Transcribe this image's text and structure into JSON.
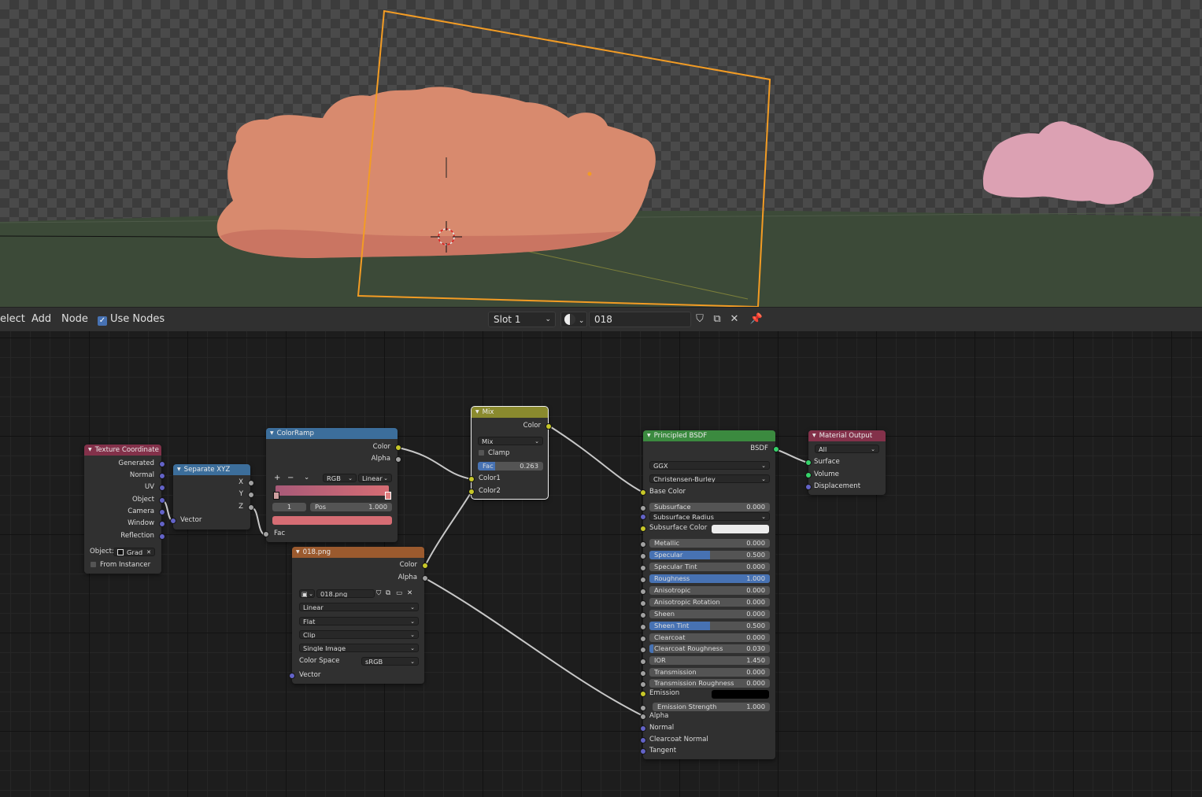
{
  "toolbar": {
    "menu_select": "elect",
    "menu_add": "Add",
    "menu_node": "Node",
    "use_nodes_label": "Use Nodes",
    "slot_value": "Slot 1",
    "material_name": "018"
  },
  "nodes": {
    "texcoord": {
      "title": "Texture Coordinate",
      "outputs": [
        "Generated",
        "Normal",
        "UV",
        "Object",
        "Camera",
        "Window",
        "Reflection"
      ],
      "object_label": "Object:",
      "object_value": "Grad",
      "from_instancer": "From Instancer"
    },
    "sepxyz": {
      "title": "Separate XYZ",
      "outputs": [
        "X",
        "Y",
        "Z"
      ],
      "input_vector": "Vector"
    },
    "colorramp": {
      "title": "ColorRamp",
      "out_color": "Color",
      "out_alpha": "Alpha",
      "add": "+",
      "remove": "−",
      "mode": "RGB",
      "interp": "Linear",
      "index": "1",
      "pos_label": "Pos",
      "pos_value": "1.000",
      "input_fac": "Fac"
    },
    "mix": {
      "title": "Mix",
      "out_color": "Color",
      "blend": "Mix",
      "clamp": "Clamp",
      "fac_label": "Fac",
      "fac_value": "0.263",
      "fac_fraction": 0.263,
      "in_color1": "Color1",
      "in_color2": "Color2"
    },
    "image": {
      "title": "018.png",
      "out_color": "Color",
      "out_alpha": "Alpha",
      "image_name": "018.png",
      "interpolation": "Linear",
      "projection": "Flat",
      "extension": "Clip",
      "source": "Single Image",
      "colorspace_label": "Color Space",
      "colorspace_value": "sRGB",
      "input_vector": "Vector"
    },
    "bsdf": {
      "title": "Principled BSDF",
      "out_bsdf": "BSDF",
      "distribution": "GGX",
      "subsurface_method": "Christensen-Burley",
      "base_color": "Base Color",
      "subsurface_radius": "Subsurface Radius",
      "subsurface_color": "Subsurface Color",
      "emission": "Emission",
      "subsurface_color_hex": "#ececec",
      "emission_color_hex": "#000000",
      "fields": [
        {
          "label": "Subsurface",
          "value": "0.000",
          "fill": 0
        },
        {
          "label": "Metallic",
          "value": "0.000",
          "fill": 0
        },
        {
          "label": "Specular",
          "value": "0.500",
          "fill": 0.5
        },
        {
          "label": "Specular Tint",
          "value": "0.000",
          "fill": 0
        },
        {
          "label": "Roughness",
          "value": "1.000",
          "fill": 1
        },
        {
          "label": "Anisotropic",
          "value": "0.000",
          "fill": 0
        },
        {
          "label": "Anisotropic Rotation",
          "value": "0.000",
          "fill": 0
        },
        {
          "label": "Sheen",
          "value": "0.000",
          "fill": 0
        },
        {
          "label": "Sheen Tint",
          "value": "0.500",
          "fill": 0.5
        },
        {
          "label": "Clearcoat",
          "value": "0.000",
          "fill": 0
        },
        {
          "label": "Clearcoat Roughness",
          "value": "0.030",
          "fill": 0.03
        },
        {
          "label": "IOR",
          "value": "1.450",
          "fill": 0
        },
        {
          "label": "Transmission",
          "value": "0.000",
          "fill": 0
        },
        {
          "label": "Transmission Roughness",
          "value": "0.000",
          "fill": 0
        },
        {
          "label": "Emission Strength",
          "value": "1.000",
          "fill": 0
        }
      ],
      "bottom_inputs": [
        "Alpha",
        "Normal",
        "Clearcoat Normal",
        "Tangent"
      ]
    },
    "output": {
      "title": "Material Output",
      "target": "All",
      "inputs": [
        "Surface",
        "Volume",
        "Displacement"
      ]
    }
  },
  "colors": {
    "texcoord_header": "#83314a",
    "sepxyz_header": "#3c6e9b",
    "colorramp_header": "#3c6e9b",
    "mix_header": "#8a8a2e",
    "image_header": "#9b5a2e",
    "bsdf_header": "#3b8a3f",
    "output_header": "#83314a",
    "accent": "#4772b3",
    "camera_frame": "#f39c24"
  }
}
